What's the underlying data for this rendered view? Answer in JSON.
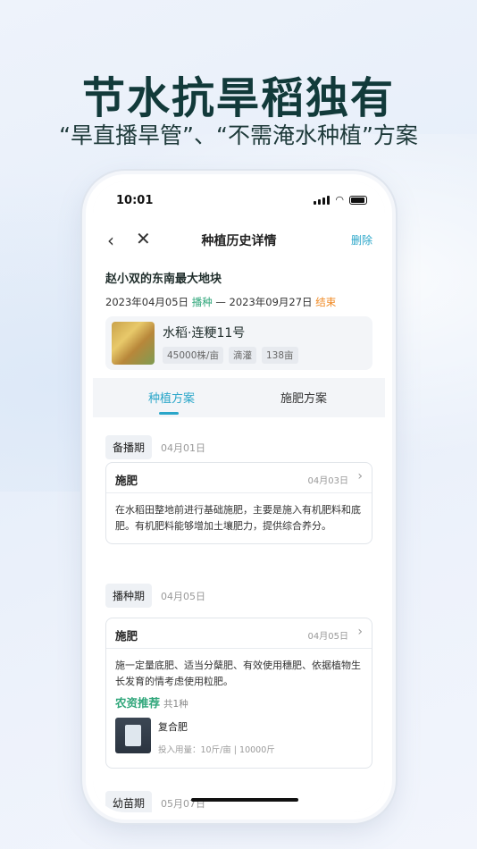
{
  "promo": {
    "headline": "节水抗旱稻独有",
    "subline": "“旱直播旱管”、“不需淹水种植”方案"
  },
  "status_bar": {
    "time": "10:01"
  },
  "nav": {
    "title": "种植历史详情",
    "delete_label": "删除"
  },
  "field": {
    "name": "赵小双的东南最大地块",
    "start_date": "2023年04月05日",
    "start_label": "播种",
    "separator": " — ",
    "end_date": "2023年09月27日",
    "end_label": "结束"
  },
  "crop": {
    "name": "水稻·连粳11号",
    "tags": [
      "45000株/亩",
      "滴灌",
      "138亩"
    ]
  },
  "tabs": [
    {
      "label": "种植方案",
      "active": true
    },
    {
      "label": "施肥方案",
      "active": false
    }
  ],
  "stages": [
    {
      "label": "备播期",
      "date": "04月01日",
      "task": {
        "title": "施肥",
        "date": "04月03日",
        "body": "在水稻田整地前进行基础施肥，主要是施入有机肥料和底肥。有机肥料能够增加土壤肥力，提供综合养分。"
      }
    },
    {
      "label": "播种期",
      "date": "04月05日",
      "task": {
        "title": "施肥",
        "date": "04月05日",
        "body": "施一定量底肥、适当分蘖肥、有效使用穗肥、依据植物生长发育的情考虑使用粒肥。",
        "recommend_title": "农资推荐",
        "recommend_count": "共1种",
        "product": {
          "name": "复合肥",
          "usage": "投入用量：10斤/亩 | 10000斤"
        }
      }
    },
    {
      "label": "幼苗期",
      "date": "05月07日"
    }
  ],
  "colors": {
    "accent": "#2aa6c9",
    "green": "#2fa67a",
    "orange": "#f08a24"
  }
}
